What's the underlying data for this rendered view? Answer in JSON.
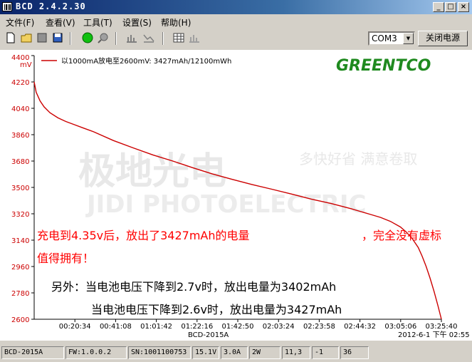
{
  "window": {
    "title": "BCD 2.4.2.30",
    "min": "_",
    "max": "□",
    "close": "×"
  },
  "menu": [
    "文件(F)",
    "查看(V)",
    "工具(T)",
    "设置(S)",
    "帮助(H)"
  ],
  "toolbar": {
    "com_port": "COM3",
    "close_power_label": "关闭电源"
  },
  "legend": "以1000mA放电至2600mV: 3427mAh/12100mWh",
  "logo": "GREENTCO",
  "watermark": {
    "cn": "极地光电",
    "cn_small": "多快好省 满意卷取",
    "en": "JIDI PHOTOELECTRIC"
  },
  "chart_data": {
    "type": "line",
    "y_unit": "mV",
    "ylim": [
      2600,
      4400
    ],
    "yticks": [
      "4400",
      "4220",
      "4040",
      "3860",
      "3680",
      "3500",
      "3320",
      "3140",
      "2960",
      "2780",
      "2600"
    ],
    "xticks": [
      "00:20:34",
      "00:41:08",
      "01:01:42",
      "01:22:16",
      "01:42:50",
      "02:03:24",
      "02:23:58",
      "02:44:32",
      "03:05:06",
      "03:25:40"
    ],
    "xlabel": "BCD-2015A",
    "date_label": "2012-6-1 下午 02:55",
    "series": [
      {
        "color": "#cc0000",
        "x_minutes": [
          0,
          1,
          3,
          5,
          8,
          12,
          16,
          20,
          25,
          30,
          40,
          50,
          60,
          70,
          80,
          90,
          100,
          110,
          120,
          130,
          140,
          150,
          160,
          170,
          175,
          180,
          185,
          188,
          191,
          194,
          196,
          198,
          200,
          202,
          204,
          205.7
        ],
        "y_mV": [
          4220,
          4150,
          4090,
          4050,
          4010,
          3975,
          3950,
          3930,
          3905,
          3880,
          3820,
          3770,
          3722,
          3680,
          3635,
          3592,
          3555,
          3520,
          3488,
          3455,
          3420,
          3390,
          3355,
          3315,
          3295,
          3268,
          3230,
          3195,
          3150,
          3090,
          3030,
          2960,
          2880,
          2790,
          2690,
          2600
        ]
      }
    ],
    "grid": false
  },
  "annotations": {
    "line1": "充电到4.35v后，放出了3427mAh的电量",
    "line1b": "，完全没有虚标",
    "line2": "值得拥有！",
    "line3": "另外：当电池电压下降到2.7v时，放出电量为3402mAh",
    "line4": "当电池电压下降到2.6v时，放出电量为3427mAh"
  },
  "status": [
    "BCD-2015A",
    "FW:1.0.0.2",
    "SN:1001100753",
    "15.1V",
    "3.0A",
    "2W",
    "11,3",
    "-1",
    "36"
  ]
}
